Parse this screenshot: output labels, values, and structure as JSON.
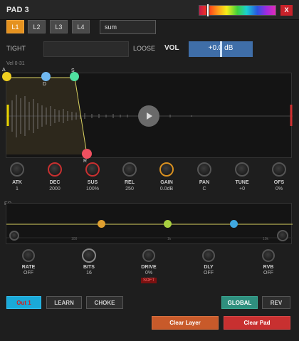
{
  "window": {
    "title": "PAD 3",
    "close_label": "X"
  },
  "colors": {
    "accent_orange": "#e5921f",
    "accent_blue": "#3f6ea8",
    "accent_red": "#c8222a",
    "accent_teal": "#2f8f7e"
  },
  "layers": [
    {
      "label": "L1",
      "active": true
    },
    {
      "label": "L2",
      "active": false
    },
    {
      "label": "L3",
      "active": false
    },
    {
      "label": "L4",
      "active": false
    }
  ],
  "pad_name": "sum",
  "tight_label": "TIGHT",
  "loose_label": "LOOSE",
  "vol_label": "VOL",
  "vol_value": "+0.0 dB",
  "velocity_range": "Vel 0-31",
  "envelope": {
    "point_labels": {
      "attack": "A",
      "decay": "D",
      "sustain": "S",
      "release": "R"
    }
  },
  "knobs": [
    {
      "label": "ATK",
      "value": "1"
    },
    {
      "label": "DEC",
      "value": "2000"
    },
    {
      "label": "SUS",
      "value": "100%"
    },
    {
      "label": "REL",
      "value": "250"
    },
    {
      "label": "GAIN",
      "value": "0.0dB"
    },
    {
      "label": "PAN",
      "value": "C"
    },
    {
      "label": "TUNE",
      "value": "+0"
    },
    {
      "label": "OFS",
      "value": "0%"
    }
  ],
  "eq": {
    "title": "EQ",
    "freq_labels": [
      "100",
      "1k",
      "10k"
    ]
  },
  "fx_knobs": [
    {
      "label": "RATE",
      "value": "OFF"
    },
    {
      "label": "BITS",
      "value": "16"
    },
    {
      "label": "DRIVE",
      "value": "0%"
    },
    {
      "label": "DLY",
      "value": "OFF"
    },
    {
      "label": "RVB",
      "value": "OFF"
    }
  ],
  "drive_mode": "SOFT",
  "buttons": {
    "out": "Out 1",
    "learn": "LEARN",
    "choke": "CHOKE",
    "global": "GLOBAL",
    "rev": "REV",
    "clear_layer": "Clear Layer",
    "clear_pad": "Clear Pad"
  }
}
